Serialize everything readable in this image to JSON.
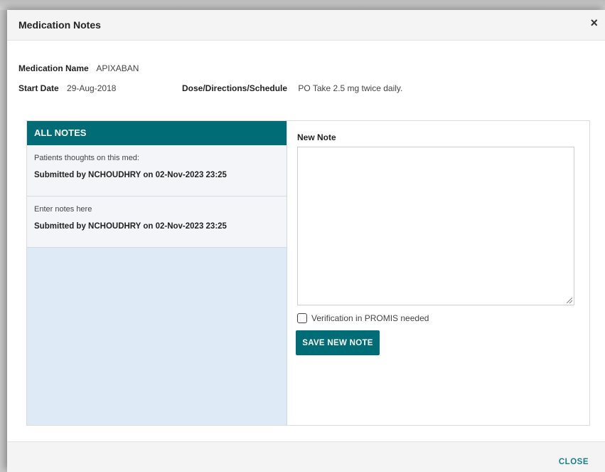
{
  "dialog": {
    "title": "Medication Notes",
    "close_icon": "×",
    "close_label": "CLOSE"
  },
  "medication": {
    "name_label": "Medication Name",
    "name_value": "APIXABAN",
    "start_label": "Start Date",
    "start_value": "29-Aug-2018",
    "dose_label": "Dose/Directions/Schedule",
    "dose_value": "PO Take 2.5 mg twice daily."
  },
  "all_notes": {
    "header": "ALL NOTES",
    "items": [
      {
        "text": "Patients thoughts on this med:",
        "meta": "Submitted by NCHOUDHRY on 02-Nov-2023 23:25"
      },
      {
        "text": "Enter notes here",
        "meta": "Submitted by NCHOUDHRY on 02-Nov-2023 23:25"
      }
    ]
  },
  "new_note": {
    "label": "New Note",
    "value": "",
    "verify_label": "Verification in PROMIS needed",
    "verify_checked": false,
    "save_label": "SAVE NEW NOTE"
  },
  "colors": {
    "accent": "#006c75",
    "notes_bg": "#deebf7",
    "link": "#1b7f8a"
  }
}
